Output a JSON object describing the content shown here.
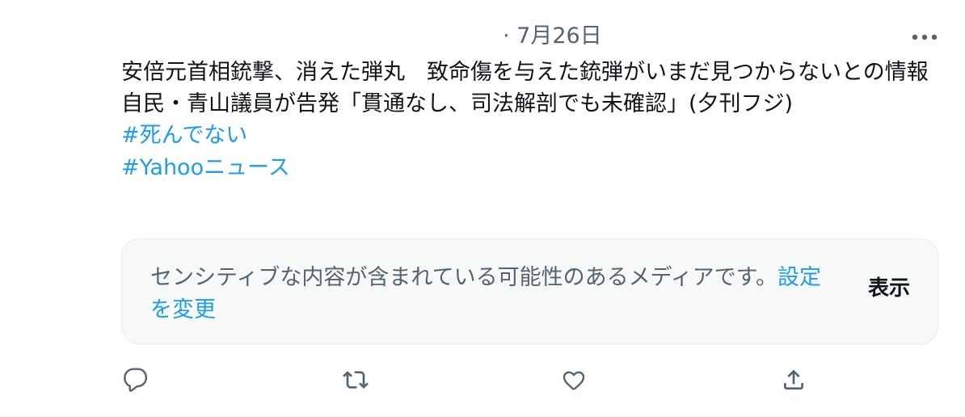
{
  "tweet": {
    "timestamp": "· 7月26日",
    "text": "安倍元首相銃撃、消えた弾丸　致命傷を与えた銃弾がいまだ見つからないとの情報　自民・青山議員が告発「貫通なし、司法解剖でも未確認」(夕刊フジ)",
    "hashtags": [
      "#死んでない",
      "#Yahooニュース"
    ]
  },
  "sensitive": {
    "message": "センシティブな内容が含まれている可能性のあるメディアです。",
    "settings_link": "設定を変更",
    "show_label": "表示"
  },
  "actions": {
    "icons": [
      "reply-icon",
      "retweet-icon",
      "like-icon",
      "share-icon"
    ]
  },
  "colors": {
    "link": "#1d9bf0",
    "secondary_text": "#536471",
    "primary_text": "#0f1419",
    "panel_bg": "#f7f9f9"
  }
}
